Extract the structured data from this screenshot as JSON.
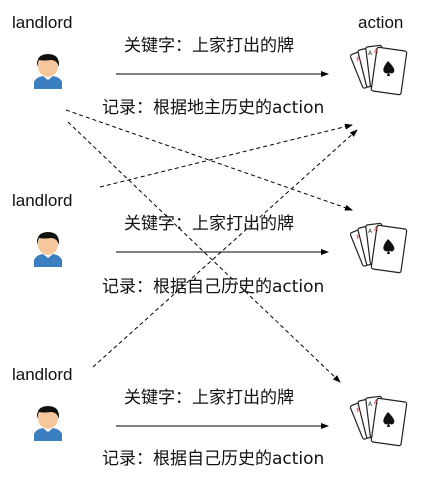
{
  "header": {
    "action_label": "action"
  },
  "rows": [
    {
      "agent": "landlord",
      "keyword": "关键字：上家打出的牌",
      "record": "记录：根据地主历史的action"
    },
    {
      "agent": "landlord",
      "keyword": "关键字：上家打出的牌",
      "record": "记录：根据自己历史的action"
    },
    {
      "agent": "landlord",
      "keyword": "关键字：上家打出的牌",
      "record": "记录：根据自己历史的action"
    }
  ],
  "icons": {
    "agent": "person-avatar-icon",
    "action": "playing-cards-icon"
  }
}
